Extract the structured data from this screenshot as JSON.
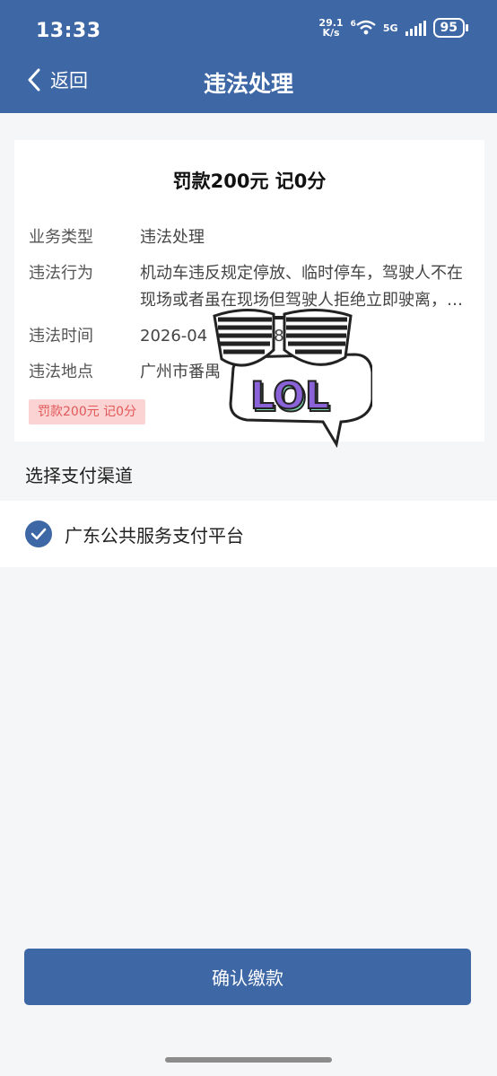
{
  "status_bar": {
    "time": "13:33",
    "net_speed": "29.1",
    "net_unit": "K/s",
    "wifi_badge": "6",
    "network": "5G",
    "battery": "95"
  },
  "header": {
    "back_label": "返回",
    "title": "违法处理"
  },
  "detail": {
    "fine_title": "罚款200元 记0分",
    "rows": [
      {
        "label": "业务类型",
        "value": "违法处理"
      },
      {
        "label": "违法行为",
        "value": "机动车违反规定停放、临时停车，驾驶人不在现场或者虽在现场但驾驶人拒绝立即驶离，妨碍其他车辆、行人通行的"
      },
      {
        "label": "违法时间",
        "value": "2026-04",
        "value_tail": "8"
      },
      {
        "label": "违法地点",
        "value": "广州市番禺"
      }
    ],
    "badge": "罚款200元 记0分"
  },
  "sticker": {
    "text": "LOL",
    "icon": "sunglasses-lol-sticker"
  },
  "payment": {
    "section_title": "选择支付渠道",
    "channel": "广东公共服务支付平台",
    "selected": true
  },
  "confirm_label": "确认缴款",
  "colors": {
    "primary": "#3e67a6",
    "badge_bg": "#fbd3d3",
    "badge_text": "#e25858"
  }
}
